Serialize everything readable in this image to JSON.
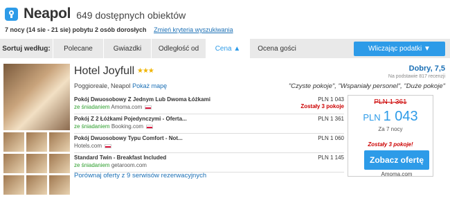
{
  "header": {
    "city": "Neapol",
    "count": "649 dostępnych obiektów",
    "stay": "7 nocy (14 sie - 21 sie) pobytu 2 osób dorosłych",
    "change_link": "Zmień kryteria wyszukiwania"
  },
  "sort": {
    "label": "Sortuj według:",
    "options": [
      "Polecane",
      "Gwiazdki",
      "Odległość od",
      "Cena ▲",
      "Ocena gości"
    ],
    "tax": "Wliczając podatki ▼"
  },
  "hotel": {
    "name": "Hotel Joyfull",
    "stars": "★★★",
    "location": "Poggioreale, Neapol",
    "map_link": "Pokaż mapę",
    "rating": "Dobry, 7,5",
    "reviews": "Na podstawie 817 recenzji",
    "quotes": "\"Czyste pokoje\", \"Wspaniały personel\", \"Duże pokoje\""
  },
  "deals": [
    {
      "title": "Pokój Dwuosobowy Z Jednym Lub Dwoma Łóżkami",
      "breakfast": "ze śniadaniem",
      "provider": "Amoma.com",
      "price": "PLN 1 043",
      "note": "Zostały 3 pokoje"
    },
    {
      "title": "Pokój Z 2 Łóżkami Pojedynczymi - Oferta...",
      "breakfast": "ze śniadaniem",
      "provider": "Booking.com",
      "price": "PLN 1 361",
      "note": ""
    },
    {
      "title": "Pokój Dwuosobowy Typu Comfort - Not...",
      "breakfast": "",
      "provider": "Hotels.com",
      "price": "PLN 1 060",
      "note": ""
    },
    {
      "title": "Standard Twin - Breakfast Included",
      "breakfast": "ze śniadaniem",
      "provider": "getaroom.com",
      "price": "PLN 1 145",
      "note": ""
    }
  ],
  "compare": "Porównaj oferty z 9 serwisów rezerwacyjnych",
  "pricebox": {
    "old": "PLN 1 361",
    "currency": "PLN",
    "amount": "1 043",
    "nights": "Za 7 nocy",
    "availability": "Zostały 3 pokoje!",
    "button": "Zobacz ofertę",
    "source": "Amoma.com"
  }
}
